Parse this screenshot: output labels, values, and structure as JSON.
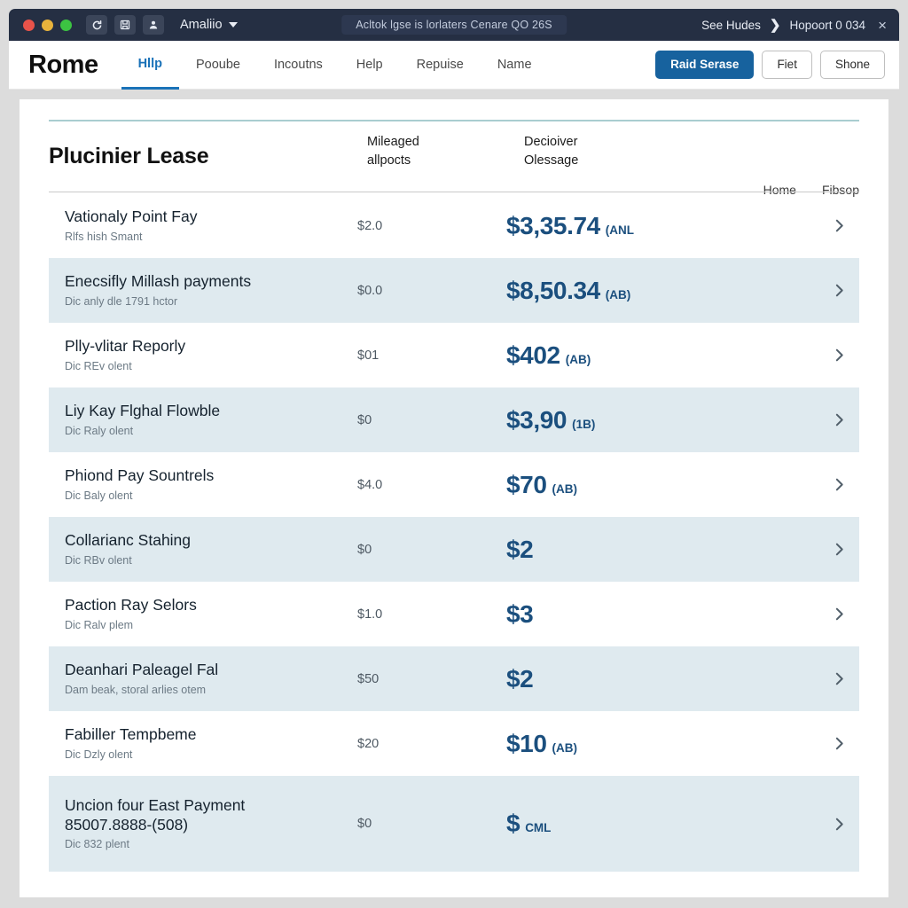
{
  "titlebar": {
    "user": "Amaliio",
    "address": "Acltok lgse is lorlaters  Cenare QO 26S",
    "right_primary": "See Hudes",
    "right_separator": "❯",
    "right_secondary": "Hopoort 0 034",
    "close": "×",
    "icons": [
      "refresh-icon",
      "save-icon",
      "account-icon"
    ]
  },
  "nav": {
    "brand": "Rome",
    "links": [
      {
        "label": "Hllp",
        "active": true
      },
      {
        "label": "Pooube",
        "active": false
      },
      {
        "label": "Incoutns",
        "active": false
      },
      {
        "label": "Help",
        "active": false
      },
      {
        "label": "Repuise",
        "active": false
      },
      {
        "label": "Name",
        "active": false
      }
    ],
    "actions": [
      {
        "label": "Raid Serase",
        "style": "primary"
      },
      {
        "label": "Fiet",
        "style": "ghost"
      },
      {
        "label": "Shone",
        "style": "ghost"
      }
    ]
  },
  "card": {
    "title": "Plucinier Lease",
    "column_headers": [
      "Mileaged\nallpocts",
      "Decioiver\nOlessage"
    ],
    "head_links": [
      "Home",
      "Fibsop"
    ],
    "rows": [
      {
        "title": "Vationaly Point Fay",
        "subtitle": "Rlfs hish Smant",
        "middle": "$2.0",
        "amount": "$3,35.74",
        "amount_suffix": "(ANL",
        "alt": false
      },
      {
        "title": "Enecsifly Millash payments",
        "subtitle": "Dic anly dle 1791 hctor",
        "middle": "$0.0",
        "amount": "$8,50.34",
        "amount_suffix": "(AB)",
        "alt": true
      },
      {
        "title": "Plly-vlitar Reporly",
        "subtitle": "Dic REv olent",
        "middle": "$01",
        "amount": "$402",
        "amount_suffix": "(AB)",
        "alt": false
      },
      {
        "title": "Liy Kay Flghal Flowble",
        "subtitle": "Dic Raly olent",
        "middle": "$0",
        "amount": "$3,90",
        "amount_suffix": "(1B)",
        "alt": true
      },
      {
        "title": "Phiond Pay Sountrels",
        "subtitle": "Dic Baly olent",
        "middle": "$4.0",
        "amount": "$70",
        "amount_suffix": "(AB)",
        "alt": false
      },
      {
        "title": "Collarianc Stahing",
        "subtitle": "Dic RBv olent",
        "middle": "$0",
        "amount": "$2",
        "amount_suffix": "",
        "alt": true
      },
      {
        "title": "Paction Ray Selors",
        "subtitle": "Dic Ralv plem",
        "middle": "$1.0",
        "amount": "$3",
        "amount_suffix": "",
        "alt": false
      },
      {
        "title": "Deanhari Paleagel Fal",
        "subtitle": "Dam beak, storal arlies otem",
        "middle": "$50",
        "amount": "$2",
        "amount_suffix": "",
        "alt": true
      },
      {
        "title": "Fabiller Tempbeme",
        "subtitle": "Dic Dzly olent",
        "middle": "$20",
        "amount": "$10",
        "amount_suffix": "(AB)",
        "alt": false
      },
      {
        "title": "Uncion four East Payment\n85007.8888-(508)",
        "subtitle": "Dic 832 plent",
        "middle": "$0",
        "amount": "$",
        "amount_suffix": "CML",
        "alt": true,
        "tall": true
      }
    ]
  },
  "colors": {
    "titlebar_bg": "#252f43",
    "accent_blue": "#17629e",
    "amount_blue": "#1b4f7e",
    "row_alt_bg": "#dfeaef",
    "card_rule_teal": "#a9cdd0"
  }
}
